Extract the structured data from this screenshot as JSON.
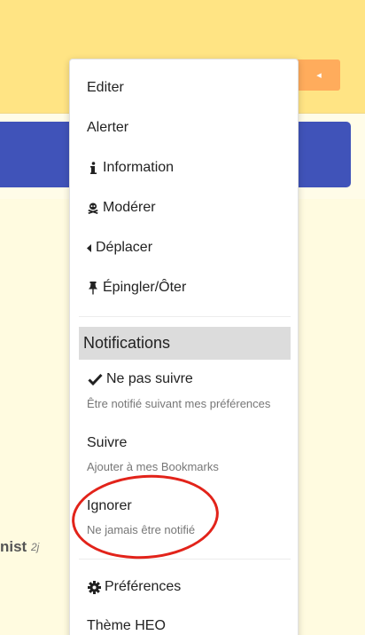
{
  "background": {
    "author_fragment": "nist",
    "author_time": "2j",
    "toggle_arrow": "◂"
  },
  "menu": {
    "items": [
      {
        "label": "Editer",
        "icon": ""
      },
      {
        "label": "Alerter",
        "icon": ""
      },
      {
        "label": "Information",
        "icon": "info-icon"
      },
      {
        "label": "Modérer",
        "icon": "skull-crossbones-icon"
      },
      {
        "label": "Déplacer",
        "icon": "caret-left-icon"
      },
      {
        "label": "Épingler/Ôter",
        "icon": "thumbtack-icon"
      }
    ],
    "notifications": {
      "header": "Notifications",
      "options": [
        {
          "label": "Ne pas suivre",
          "description": "Être notifié suivant mes préférences",
          "icon": "check-icon",
          "selected": true
        },
        {
          "label": "Suivre",
          "description": "Ajouter à mes Bookmarks",
          "icon": "",
          "selected": false
        },
        {
          "label": "Ignorer",
          "description": "Ne jamais être notifié",
          "icon": "",
          "selected": false
        }
      ]
    },
    "footer": [
      {
        "label": "Préférences",
        "icon": "gear-icon"
      },
      {
        "label": "Thème HEO",
        "icon": ""
      }
    ]
  },
  "colors": {
    "topbar": "#ffe484",
    "accent_orange": "#ffac5c",
    "bluebar": "#4053b9",
    "highlight_circle": "#e2231a"
  }
}
